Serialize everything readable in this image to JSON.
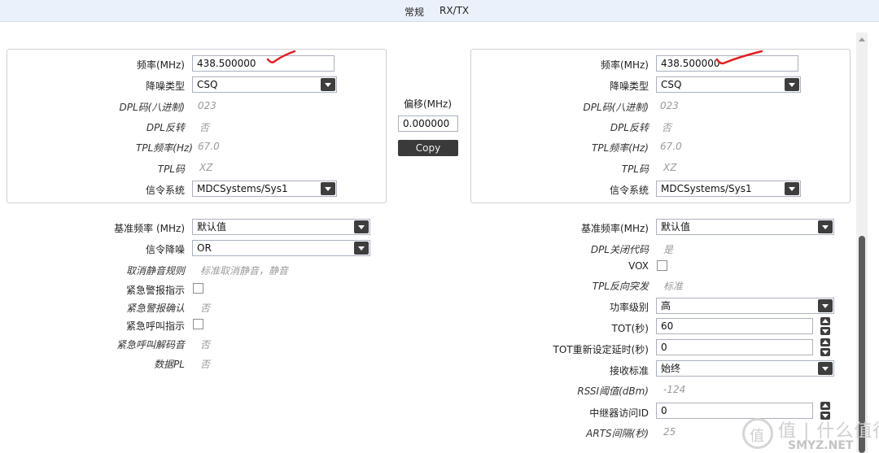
{
  "tabs": [
    {
      "label": "常规"
    },
    {
      "label": "RX/TX"
    }
  ],
  "rx_panel": {
    "freq_label": "频率(MHz)",
    "freq_value": "438.500000",
    "squelch_type_label": "降噪类型",
    "squelch_type_value": "CSQ",
    "dpl_code_label": "DPL码(八进制)",
    "dpl_code_value": "023",
    "dpl_invert_label": "DPL反转",
    "dpl_invert_value": "否",
    "tpl_freq_label": "TPL频率(Hz)",
    "tpl_freq_value": "67.0",
    "tpl_code_label": "TPL码",
    "tpl_code_value": "XZ",
    "signaling_label": "信令系统",
    "signaling_value": "MDCSystems/Sys1"
  },
  "offset": {
    "label": "偏移(MHz)",
    "value": "0.000000",
    "copy_label": "Copy"
  },
  "tx_panel": {
    "freq_label": "频率(MHz)",
    "freq_value": "438.500000",
    "squelch_type_label": "降噪类型",
    "squelch_type_value": "CSQ",
    "dpl_code_label": "DPL码(八进制)",
    "dpl_code_value": "023",
    "dpl_invert_label": "DPL反转",
    "dpl_invert_value": "否",
    "tpl_freq_label": "TPL频率(Hz)",
    "tpl_freq_value": "67.0",
    "tpl_code_label": "TPL码",
    "tpl_code_value": "XZ",
    "signaling_label": "信令系统",
    "signaling_value": "MDCSystems/Sys1"
  },
  "rx_extra": {
    "ref_freq_label": "基准频率 (MHz)",
    "ref_freq_value": "默认值",
    "signal_squelch_label": "信令降噪",
    "signal_squelch_value": "OR",
    "unmute_rule_label": "取消静音规则",
    "unmute_rule_value": "标准取消静音，静音",
    "emergency_alert_label": "紧急警报指示",
    "emergency_ack_label": "紧急警报确认",
    "emergency_ack_value": "否",
    "emergency_call_label": "紧急呼叫指示",
    "emergency_decode_label": "紧急呼叫解码音",
    "emergency_decode_value": "否",
    "data_pl_label": "数据PL",
    "data_pl_value": "否"
  },
  "tx_extra": {
    "ref_freq_label": "基准频率(MHz)",
    "ref_freq_value": "默认值",
    "dpl_turnoff_label": "DPL关闭代码",
    "dpl_turnoff_value": "是",
    "vox_label": "VOX",
    "tpl_reverse_label": "TPL反向突发",
    "tpl_reverse_value": "标准",
    "power_label": "功率级别",
    "power_value": "高",
    "tot_label": "TOT(秒)",
    "tot_value": "60",
    "tot_reset_label": "TOT重新设定延时(秒)",
    "tot_reset_value": "0",
    "rx_standard_label": "接收标准",
    "rx_standard_value": "始终",
    "rssi_label": "RSSI阈值(dBm)",
    "rssi_value": "-124",
    "repeater_label": "中继器访问ID",
    "repeater_value": "0",
    "arts_label": "ARTS间隔(秒)",
    "arts_value": "25"
  },
  "watermark": {
    "big": "值 | 什么值得买",
    "small": "SMYZ.NET"
  },
  "colors": {
    "annotation_red": "#e02020",
    "tabbar_bg": "#eaf1fa",
    "dropdown_button": "#3e3e3e"
  }
}
